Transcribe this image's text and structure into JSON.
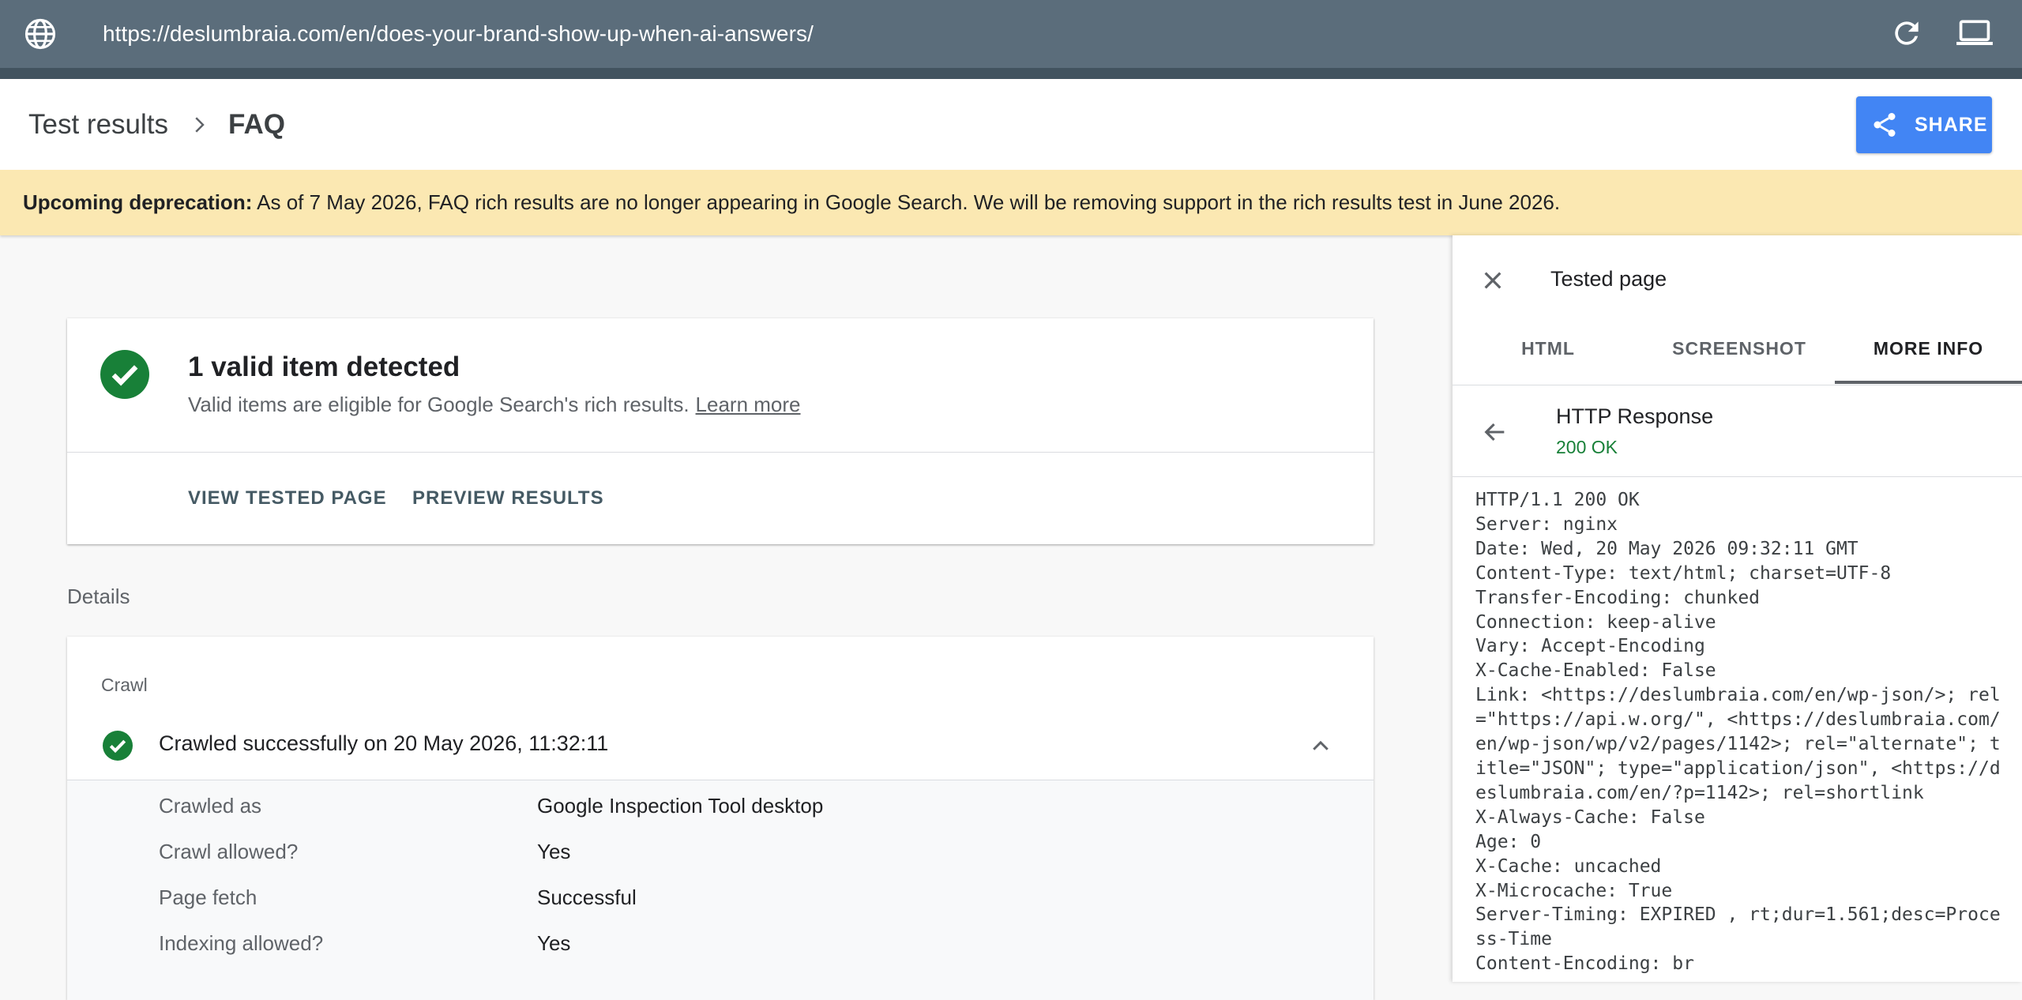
{
  "browser": {
    "url": "https://deslumbraia.com/en/does-your-brand-show-up-when-ai-answers/",
    "icons": [
      "globe-icon",
      "reload-icon",
      "laptop-icon"
    ]
  },
  "header": {
    "breadcrumb_parent": "Test results",
    "breadcrumb_current": "FAQ",
    "share_label": "SHARE"
  },
  "banner": {
    "strong": "Upcoming deprecation:",
    "text": " As of 7 May 2026, FAQ rich results are no longer appearing in Google Search. We will be removing support in the rich results test in June 2026."
  },
  "summary": {
    "title": "1 valid item detected",
    "subtitle": "Valid items are eligible for Google Search's rich results.",
    "learn_more": "Learn more",
    "view_tested_page": "VIEW TESTED PAGE",
    "preview_results": "PREVIEW RESULTS"
  },
  "details": {
    "label": "Details",
    "crawl": {
      "heading": "Crawl",
      "status": "Crawled successfully on 20 May 2026, 11:32:11",
      "rows": [
        {
          "key": "Crawled as",
          "value": "Google Inspection Tool desktop"
        },
        {
          "key": "Crawl allowed?",
          "value": "Yes"
        },
        {
          "key": "Page fetch",
          "value": "Successful"
        },
        {
          "key": "Indexing allowed?",
          "value": "Yes"
        }
      ]
    }
  },
  "panel": {
    "title": "Tested page",
    "tabs": [
      "HTML",
      "SCREENSHOT",
      "MORE INFO"
    ],
    "active_tab": "MORE INFO",
    "response_title": "HTTP Response",
    "response_status": "200 OK",
    "headers": "HTTP/1.1 200 OK\nServer: nginx\nDate: Wed, 20 May 2026 09:32:11 GMT\nContent-Type: text/html; charset=UTF-8\nTransfer-Encoding: chunked\nConnection: keep-alive\nVary: Accept-Encoding\nX-Cache-Enabled: False\nLink: <https://deslumbraia.com/en/wp-json/>; rel=\"https://api.w.org/\", <https://deslumbraia.com/en/wp-json/wp/v2/pages/1142>; rel=\"alternate\"; title=\"JSON\"; type=\"application/json\", <https://deslumbraia.com/en/?p=1142>; rel=shortlink\nX-Always-Cache: False\nAge: 0\nX-Cache: uncached\nX-Microcache: True\nServer-Timing: EXPIRED , rt;dur=1.561;desc=Process-Time\nContent-Encoding: br"
  },
  "colors": {
    "browser_bar": "#5b6d7b",
    "share_blue": "#4285f4",
    "banner_yellow": "#fbe8b2",
    "success_green": "#188038"
  }
}
